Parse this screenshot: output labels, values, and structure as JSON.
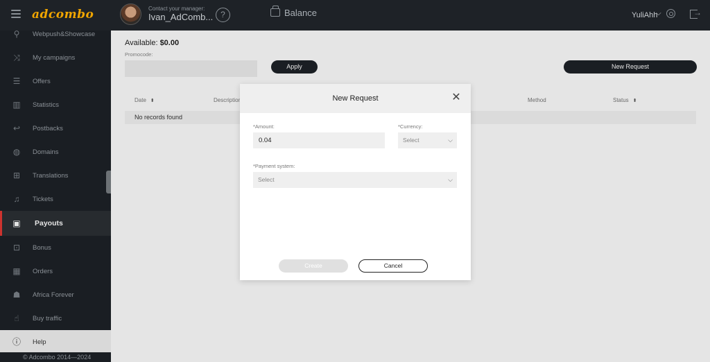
{
  "header": {
    "logo_text": "adcombo",
    "manager_caption": "Contact your manager:",
    "manager_name": "Ivan_AdComb...",
    "help_glyph": "?",
    "balance_label": "Balance",
    "user_name": "YuliAhh"
  },
  "sidebar": {
    "items": [
      {
        "label": "Webpush&Showcase",
        "icon": "webpush-icon"
      },
      {
        "label": "My campaigns",
        "icon": "shuffle-icon"
      },
      {
        "label": "Offers",
        "icon": "list-icon"
      },
      {
        "label": "Statistics",
        "icon": "bar-chart-icon"
      },
      {
        "label": "Postbacks",
        "icon": "return-arrow-icon"
      },
      {
        "label": "Domains",
        "icon": "globe-icon"
      },
      {
        "label": "Translations",
        "icon": "translate-icon"
      },
      {
        "label": "Tickets",
        "icon": "bell-icon"
      },
      {
        "label": "Payouts",
        "icon": "wallet-icon"
      },
      {
        "label": "Bonus",
        "icon": "gift-icon"
      },
      {
        "label": "Orders",
        "icon": "calendar-icon"
      },
      {
        "label": "Africa Forever",
        "icon": "user-icon"
      },
      {
        "label": "Buy traffic",
        "icon": "hand-icon"
      },
      {
        "label": "Help",
        "icon": "info-icon"
      }
    ],
    "active_item": "Payouts",
    "copyright": "© Adcombo 2014—2024"
  },
  "main": {
    "available_label": "Available:",
    "available_value": "$0.00",
    "promocode_label": "Promocode:",
    "apply_label": "Apply",
    "new_request_label": "New Request",
    "table": {
      "columns": [
        "Date",
        "Description",
        "Method",
        "Status"
      ],
      "empty_text": "No records found"
    }
  },
  "modal": {
    "title": "New Request",
    "amount_label": "*Amount:",
    "amount_value": "0.04",
    "currency_label": "*Currency:",
    "currency_value": "Select",
    "payment_label": "*Payment system:",
    "payment_value": "Select",
    "create_label": "Create",
    "cancel_label": "Cancel"
  },
  "colors": {
    "dark": "#1e2227",
    "active_marker": "#e53935",
    "logo": "#f0a500"
  }
}
